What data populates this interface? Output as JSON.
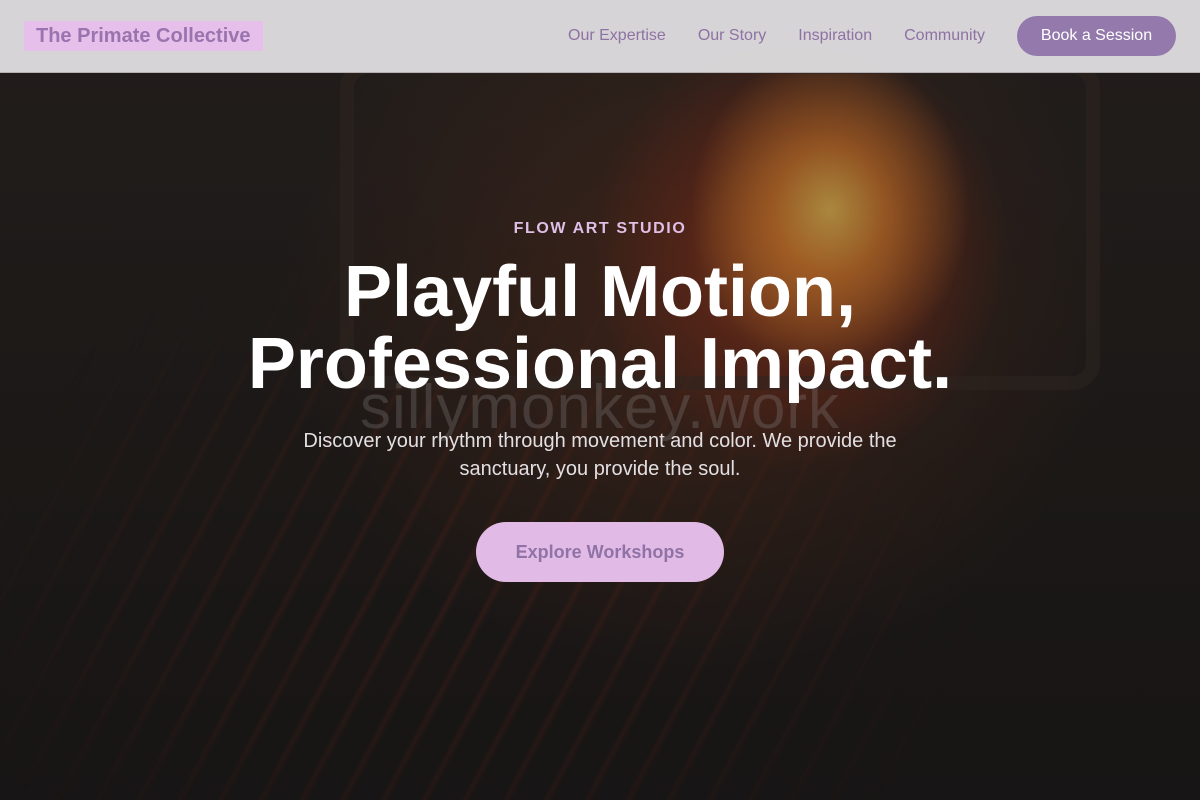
{
  "header": {
    "brand": "The Primate Collective",
    "nav": [
      "Our Expertise",
      "Our Story",
      "Inspiration",
      "Community"
    ],
    "cta": "Book a Session"
  },
  "hero": {
    "eyebrow": "FLOW ART STUDIO",
    "headline_line1": "Playful Motion,",
    "headline_line2": "Professional Impact.",
    "subtitle": "Discover your rhythm through movement and color. We provide the sanctuary, you provide the soul.",
    "cta": "Explore Workshops",
    "watermark": "sillymonkey.work"
  },
  "colors": {
    "brand_bg": "#e6c0ea",
    "brand_text": "#9a74ae",
    "nav_text": "#8d72a3",
    "cta_top_bg": "#9479ac",
    "cta_main_bg": "#e2bae6",
    "eyebrow": "#e0bfe6"
  }
}
